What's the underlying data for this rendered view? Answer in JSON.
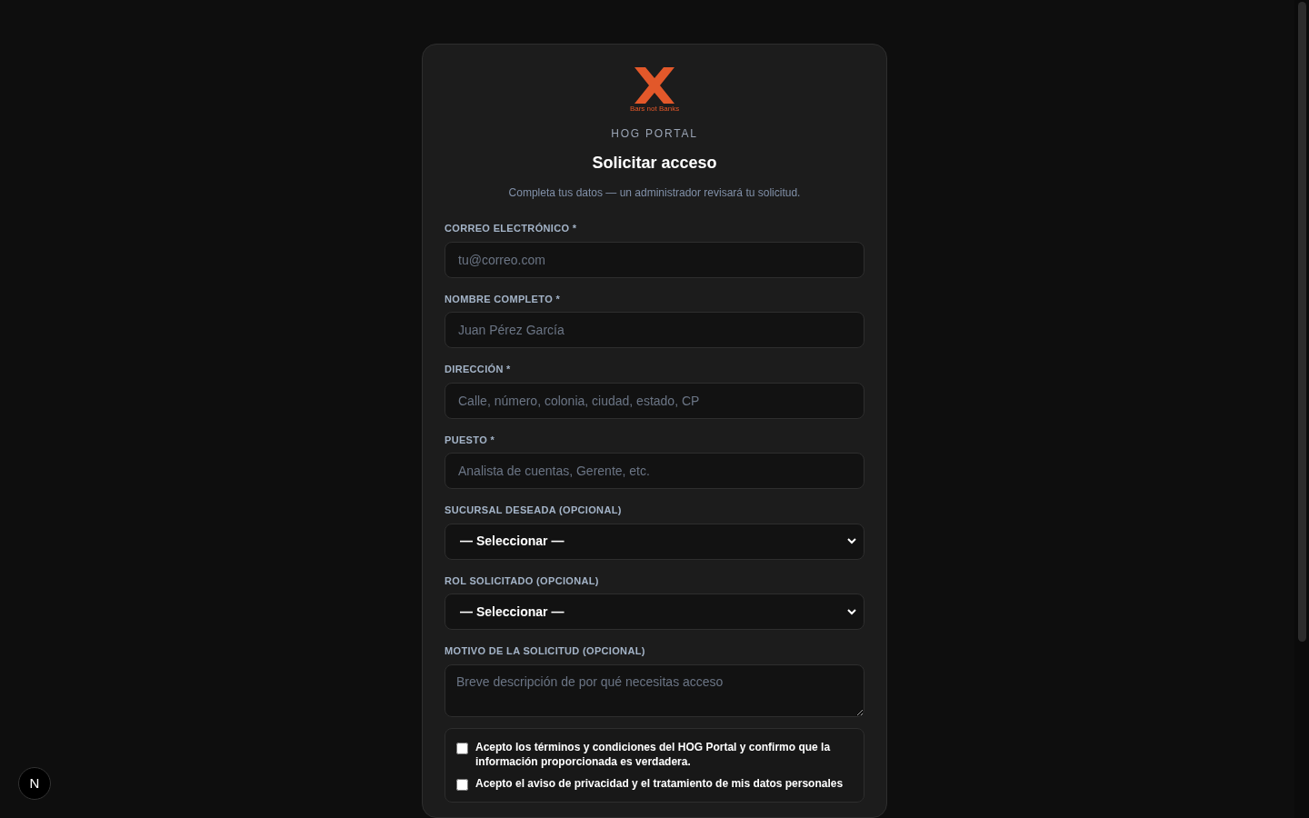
{
  "brand": {
    "tagline": "Bars not Banks",
    "portal": "HOG PORTAL"
  },
  "title": "Solicitar acceso",
  "subtitle": "Completa tus datos — un administrador revisará tu solicitud.",
  "fields": [
    {
      "kind": "input",
      "label": "CORREO ELECTRÓNICO *",
      "placeholder": "tu@correo.com"
    },
    {
      "kind": "input",
      "label": "NOMBRE COMPLETO *",
      "placeholder": "Juan Pérez García"
    },
    {
      "kind": "input",
      "label": "DIRECCIÓN *",
      "placeholder": "Calle, número, colonia, ciudad, estado, CP"
    },
    {
      "kind": "input",
      "label": "PUESTO *",
      "placeholder": "Analista de cuentas, Gerente, etc."
    },
    {
      "kind": "select",
      "label": "SUCURSAL DESEADA (OPCIONAL)",
      "value": "— Seleccionar —"
    },
    {
      "kind": "select",
      "label": "ROL SOLICITADO (OPCIONAL)",
      "value": "— Seleccionar —"
    },
    {
      "kind": "textarea",
      "label": "MOTIVO DE LA SOLICITUD (OPCIONAL)",
      "placeholder": "Breve descripción de por qué necesitas acceso"
    }
  ],
  "consents": [
    {
      "text": "Acepto los términos y condiciones del HOG Portal y confirmo que la información proporcionada es verdadera.",
      "checked": false
    },
    {
      "text": "Acepto el aviso de privacidad y el tratamiento de mis datos personales",
      "checked": false
    }
  ],
  "dev_badge": {
    "letter": "N"
  }
}
